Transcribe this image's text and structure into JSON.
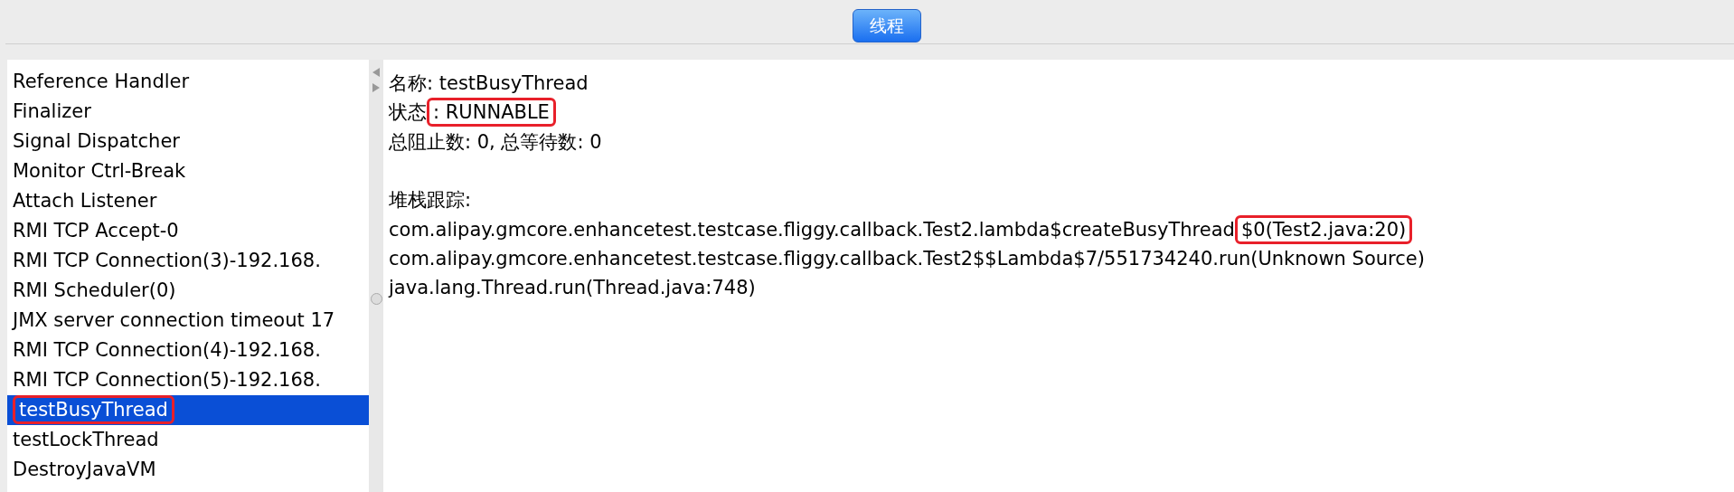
{
  "tabs": [
    {
      "label": "线程",
      "selected": true
    }
  ],
  "threads": [
    {
      "name": "Reference Handler",
      "selected": false,
      "highlighted": false
    },
    {
      "name": "Finalizer",
      "selected": false,
      "highlighted": false
    },
    {
      "name": "Signal Dispatcher",
      "selected": false,
      "highlighted": false
    },
    {
      "name": "Monitor Ctrl-Break",
      "selected": false,
      "highlighted": false
    },
    {
      "name": "Attach Listener",
      "selected": false,
      "highlighted": false
    },
    {
      "name": "RMI TCP Accept-0",
      "selected": false,
      "highlighted": false
    },
    {
      "name": "RMI TCP Connection(3)-192.168.",
      "selected": false,
      "highlighted": false
    },
    {
      "name": "RMI Scheduler(0)",
      "selected": false,
      "highlighted": false
    },
    {
      "name": "JMX server connection timeout 17",
      "selected": false,
      "highlighted": false
    },
    {
      "name": "RMI TCP Connection(4)-192.168.",
      "selected": false,
      "highlighted": false
    },
    {
      "name": "RMI TCP Connection(5)-192.168.",
      "selected": false,
      "highlighted": false
    },
    {
      "name": "testBusyThread",
      "selected": true,
      "highlighted": true
    },
    {
      "name": "testLockThread",
      "selected": false,
      "highlighted": false
    },
    {
      "name": "DestroyJavaVM",
      "selected": false,
      "highlighted": false
    }
  ],
  "details": {
    "name_line": "名称: testBusyThread",
    "state_label": "状态",
    "state_value": ": RUNNABLE",
    "state_highlighted": true,
    "counts_line": "总阻止数: 0, 总等待数: 0",
    "stack_label": "堆栈跟踪:",
    "frames": [
      {
        "text": "com.alipay.gmcore.enhancetest.testcase.fliggy.callback.Test2.lambda$createBusyThread",
        "marked": "$0(Test2.java:20)"
      },
      {
        "text": "com.alipay.gmcore.enhancetest.testcase.fliggy.callback.Test2$$Lambda$7/551734240.run(Unknown Source)"
      },
      {
        "text": "java.lang.Thread.run(Thread.java:748)"
      }
    ]
  }
}
